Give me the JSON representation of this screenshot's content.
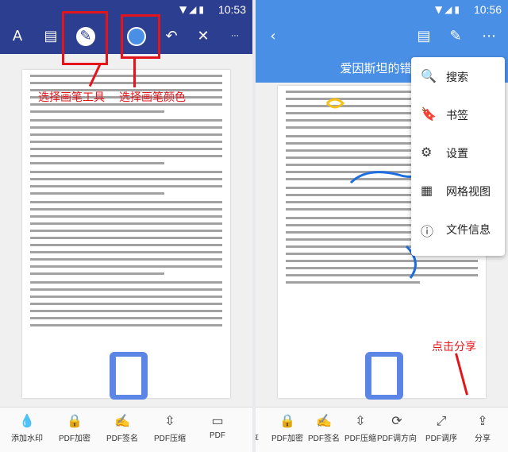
{
  "left": {
    "status_time": "10:53",
    "annotations": [
      "选择画笔工具",
      "选择画笔颜色"
    ],
    "bottom_items": [
      "添加水印",
      "PDF加密",
      "PDF签名",
      "PDF压缩",
      "PDF"
    ]
  },
  "right": {
    "status_time": "10:56",
    "title": "爱因斯坦的错误",
    "menu": [
      "搜索",
      "书签",
      "设置",
      "网格视图",
      "文件信息"
    ],
    "annotation": "点击分享",
    "bottom_items": [
      "分享",
      "PDF加密",
      "PDF签名",
      "PDF压缩",
      "PDF调方向",
      "PDF调序",
      "分享"
    ]
  },
  "colors": {
    "toolbar": "#2c3e8f",
    "accent": "#4a8fe6",
    "annot": "#e3141b"
  }
}
